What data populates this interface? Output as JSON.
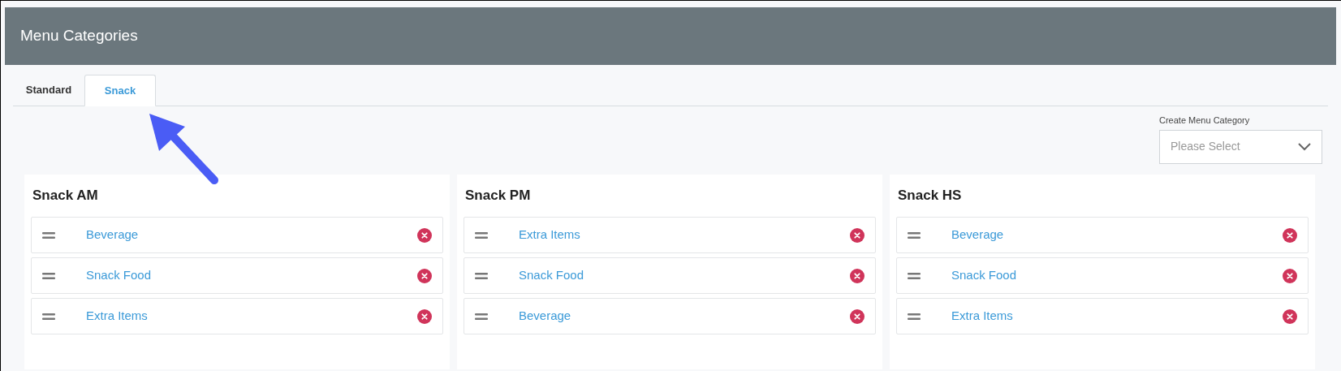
{
  "header": {
    "title": "Menu Categories"
  },
  "tabs": [
    {
      "label": "Standard",
      "selected": false
    },
    {
      "label": "Snack",
      "selected": true
    }
  ],
  "create_menu_category": {
    "label": "Create Menu Category",
    "placeholder": "Please Select"
  },
  "cards": [
    {
      "title": "Snack AM",
      "items": [
        "Beverage",
        "Snack Food",
        "Extra Items"
      ]
    },
    {
      "title": "Snack PM",
      "items": [
        "Extra Items",
        "Snack Food",
        "Beverage"
      ]
    },
    {
      "title": "Snack HS",
      "items": [
        "Beverage",
        "Snack Food",
        "Extra Items"
      ]
    }
  ]
}
